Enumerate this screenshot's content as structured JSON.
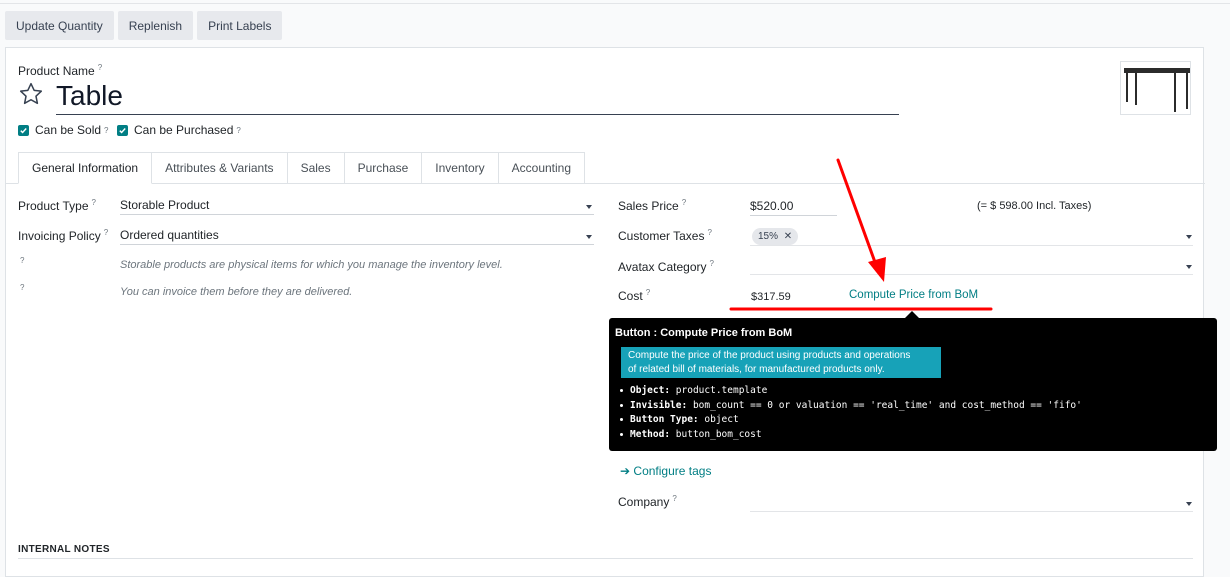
{
  "toolbar": {
    "buttons": [
      "Update Quantity",
      "Replenish",
      "Print Labels"
    ]
  },
  "product": {
    "name_label": "Product Name",
    "name": "Table",
    "can_be_sold_label": "Can be Sold",
    "can_be_purchased_label": "Can be Purchased",
    "help_mark": "?"
  },
  "tabs": [
    "General Information",
    "Attributes & Variants",
    "Sales",
    "Purchase",
    "Inventory",
    "Accounting"
  ],
  "left_fields": {
    "product_type_label": "Product Type",
    "product_type_value": "Storable Product",
    "invoicing_policy_label": "Invoicing Policy",
    "invoicing_policy_value": "Ordered quantities",
    "help1": "Storable products are physical items for which you manage the inventory level.",
    "help2": "You can invoice them before they are delivered."
  },
  "right_fields": {
    "sales_price_label": "Sales Price",
    "sales_price_value": "$520.00",
    "incl_taxes": "(= $ 598.00 Incl. Taxes)",
    "customer_taxes_label": "Customer Taxes",
    "tax_tag": "15%",
    "avatax_label": "Avatax Category",
    "cost_label": "Cost",
    "cost_value": "$317.59",
    "compute_link": "Compute Price from BoM",
    "configure_tags": "Configure tags",
    "company_label": "Company"
  },
  "tooltip": {
    "title": "Button : Compute Price from BoM",
    "description_line1": "Compute the price of the product using products and operations",
    "description_line2": "of related bill of materials, for manufactured products only.",
    "items": [
      {
        "key": "Object:",
        "value": "product.template"
      },
      {
        "key": "Invisible:",
        "value": "bom_count == 0 or valuation == 'real_time' and cost_method == 'fifo'"
      },
      {
        "key": "Button Type:",
        "value": "object"
      },
      {
        "key": "Method:",
        "value": "button_bom_cost"
      }
    ]
  },
  "notes": {
    "label": "INTERNAL NOTES"
  },
  "colors": {
    "accent": "#017e84",
    "tooltip_highlight": "#17a2b8",
    "annotation_red": "#ff0000"
  }
}
